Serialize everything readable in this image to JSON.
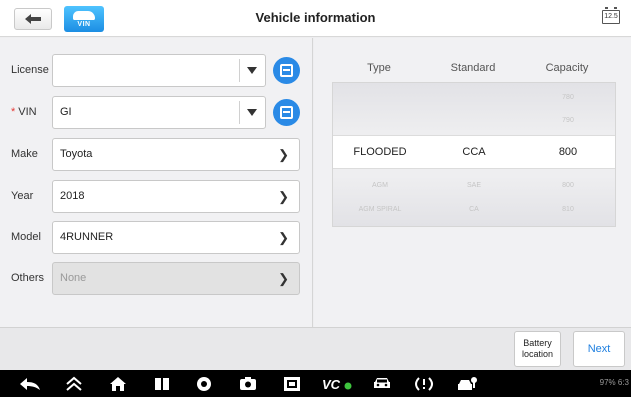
{
  "header": {
    "title": "Vehicle information",
    "vin_badge": "VIN",
    "battery_icon_text": "12.5"
  },
  "form": {
    "license": {
      "label": "License",
      "value": ""
    },
    "vin": {
      "required_mark": "*",
      "label": "VIN",
      "value": "GI"
    },
    "make": {
      "label": "Make",
      "value": "Toyota"
    },
    "year": {
      "label": "Year",
      "value": "2018"
    },
    "model": {
      "label": "Model",
      "value": "4RUNNER"
    },
    "others": {
      "label": "Others",
      "value": "None"
    }
  },
  "picker": {
    "columns": [
      "Type",
      "Standard",
      "Capacity"
    ],
    "rows": [
      {
        "type": "",
        "standard": "",
        "capacity": "780"
      },
      {
        "type": "",
        "standard": "",
        "capacity": "790"
      },
      {
        "type": "AGM",
        "standard": "SAE",
        "capacity": "800"
      },
      {
        "type": "AGM SPIRAL",
        "standard": "CA",
        "capacity": "810"
      }
    ],
    "selected": {
      "type": "FLOODED",
      "standard": "CCA",
      "capacity": "800"
    }
  },
  "actions": {
    "battery_location_line1": "Battery",
    "battery_location_line2": "location",
    "next": "Next"
  },
  "status_bar": {
    "text": "97% 6:3"
  },
  "icons": [
    "back-arrow-icon",
    "vin-car-icon",
    "battery-status-icon",
    "dropdown-arrow-icon",
    "scan-icon",
    "chevron-right-icon",
    "nav-back-icon",
    "nav-up-icon",
    "nav-home-icon",
    "nav-recent-icon",
    "chrome-icon",
    "camera-icon",
    "screenshot-icon",
    "vci-icon",
    "car-icon",
    "tpms-icon",
    "car-wrench-icon"
  ],
  "colors": {
    "accent": "#1e7fe0",
    "scan_button": "#2a8ae6",
    "required": "#e53935",
    "nav_bar": "#000000"
  }
}
